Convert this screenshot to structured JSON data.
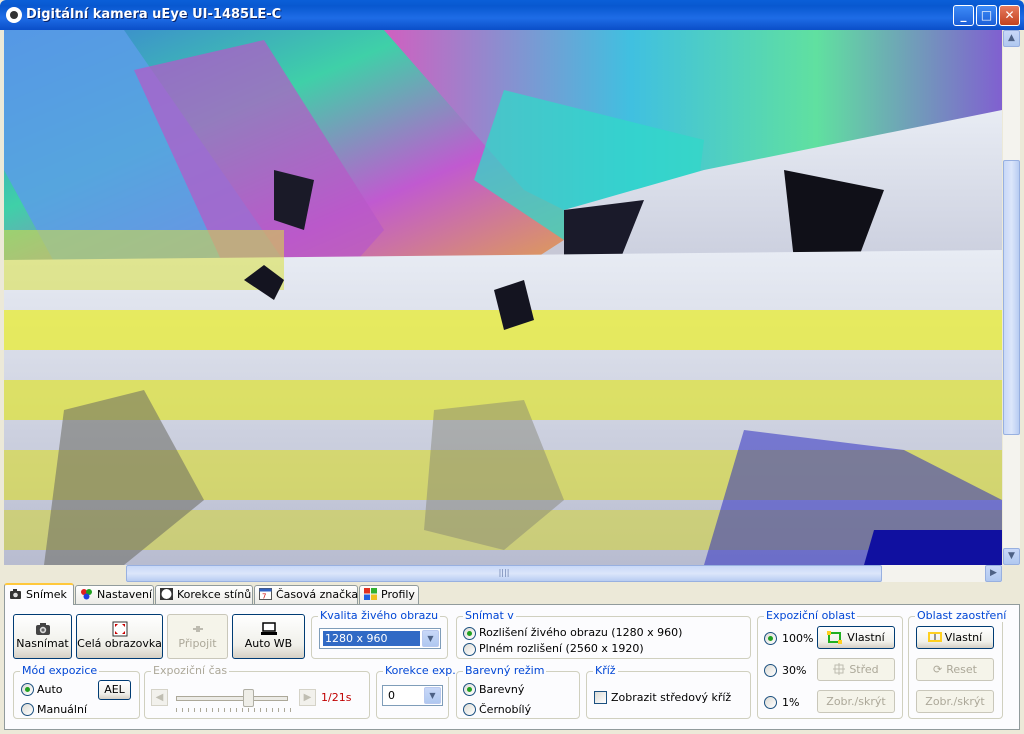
{
  "window": {
    "title": "Digitální kamera uEye UI-1485LE-C",
    "minimize_glyph": "_",
    "maximize_glyph": "□",
    "close_glyph": "✕"
  },
  "tabs": [
    {
      "label": "Snímek",
      "icon": "camera-icon",
      "active": true
    },
    {
      "label": "Nastavení",
      "icon": "color-dots-icon",
      "active": false
    },
    {
      "label": "Korekce stínů",
      "icon": "shading-icon",
      "active": false
    },
    {
      "label": "Časová značka",
      "icon": "calendar-icon",
      "active": false
    },
    {
      "label": "Profily",
      "icon": "windows-flag-icon",
      "active": false
    }
  ],
  "toolbar": {
    "capture_label": "Nasnímat",
    "fullscreen_label": "Celá obrazovka",
    "connect_label": "Připojit",
    "autowb_label": "Auto WB"
  },
  "live_quality": {
    "title": "Kvalita živého obrazu",
    "selected": "1280 x 960"
  },
  "capture_in": {
    "title": "Snímat v",
    "option_live": "Rozlišení živého obrazu (1280 x 960)",
    "option_full": "Plném rozlišení (2560 x 1920)",
    "selected": "live"
  },
  "exposure_area": {
    "title": "Expoziční oblast",
    "opt100": "100%",
    "opt30": "30%",
    "opt1": "1%",
    "selected": "100%",
    "custom_label": "Vlastní",
    "center_label": "Střed",
    "toggle_label": "Zobr./skrýt"
  },
  "focus_area": {
    "title": "Oblast zaostření",
    "custom_label": "Vlastní",
    "reset_label": "Reset",
    "toggle_label": "Zobr./skrýt"
  },
  "exposure_mode": {
    "title": "Mód expozice",
    "auto_label": "Auto",
    "manual_label": "Manuální",
    "ael_label": "AEL",
    "selected": "auto"
  },
  "exposure_time": {
    "title": "Expoziční čas",
    "value": "1/21s",
    "slider_fraction": 0.62
  },
  "exposure_correction": {
    "title": "Korekce exp.",
    "selected": "0"
  },
  "color_mode": {
    "title": "Barevný režim",
    "color_label": "Barevný",
    "bw_label": "Černobílý",
    "selected": "color"
  },
  "cross": {
    "title": "Kříž",
    "show_center_label": "Zobrazit středový kříž",
    "checked": false
  },
  "colors": {
    "accent": "#0046D5",
    "exposure_value": "#C00000",
    "tab_highlight": "#FFC83C"
  }
}
